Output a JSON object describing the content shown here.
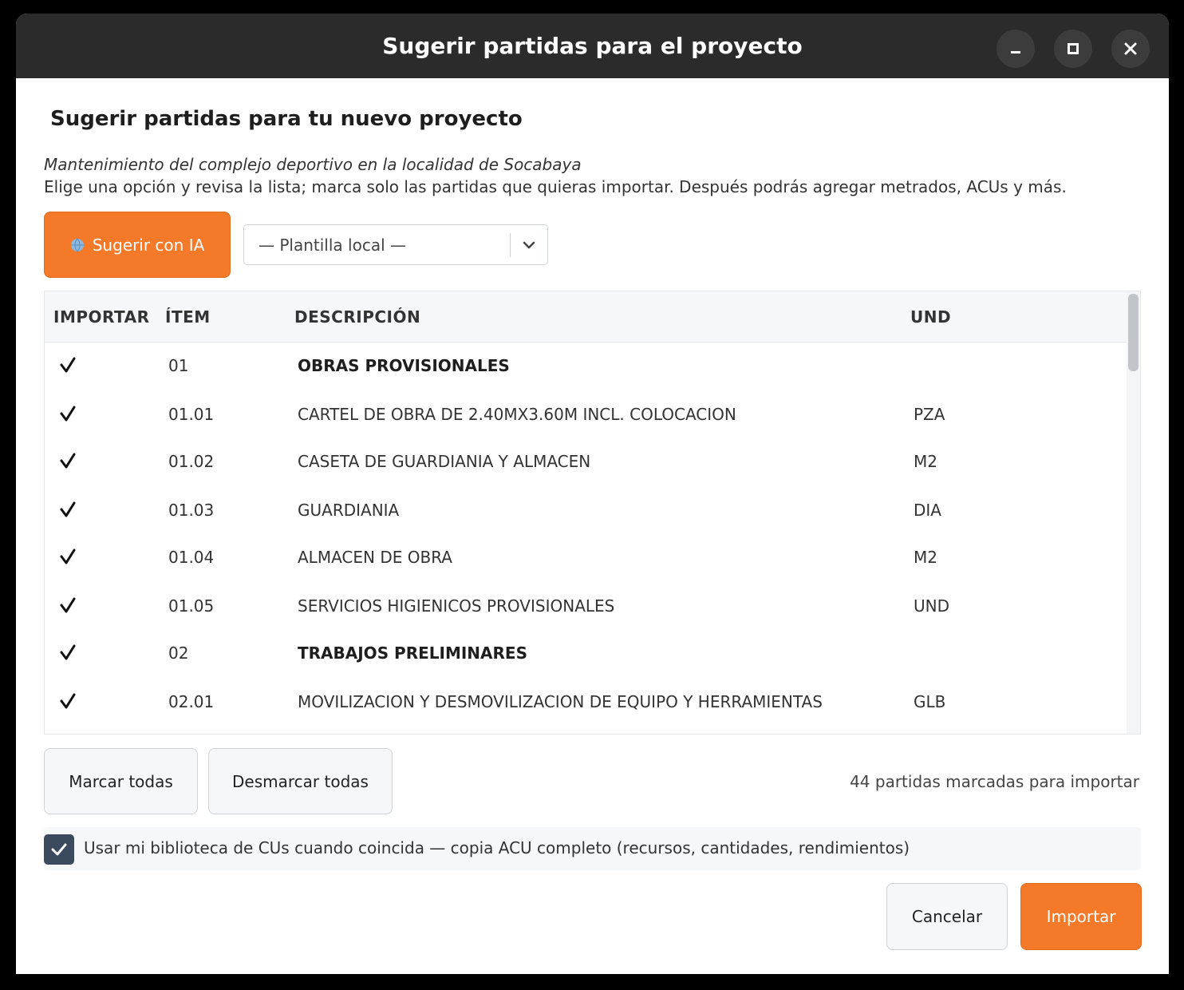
{
  "window": {
    "title": "Sugerir partidas para el proyecto",
    "controls": [
      "minimize-icon",
      "maximize-icon",
      "close-icon"
    ]
  },
  "header": {
    "title": "Sugerir partidas para tu nuevo proyecto",
    "project_name": "Mantenimiento del complejo deportivo en la localidad de Socabaya",
    "instructions": "Elige una opción y revisa la lista; marca solo las partidas que quieras importar. Después podrás agregar metrados, ACUs y más."
  },
  "toolbar": {
    "suggest_ai_label": "Sugerir con IA",
    "suggest_ai_icon": "globe-icon",
    "template_select_value": "— Plantilla local —"
  },
  "table": {
    "columns": {
      "importar": "IMPORTAR",
      "item": "ÍTEM",
      "descripcion": "DESCRIPCIÓN",
      "und": "UND"
    },
    "rows": [
      {
        "checked": true,
        "item": "01",
        "descripcion": "OBRAS PROVISIONALES",
        "und": "",
        "is_group": true
      },
      {
        "checked": true,
        "item": "01.01",
        "descripcion": "CARTEL DE OBRA DE 2.40MX3.60M INCL. COLOCACION",
        "und": "PZA",
        "is_group": false
      },
      {
        "checked": true,
        "item": "01.02",
        "descripcion": "CASETA DE GUARDIANIA Y ALMACEN",
        "und": "M2",
        "is_group": false
      },
      {
        "checked": true,
        "item": "01.03",
        "descripcion": "GUARDIANIA",
        "und": "DIA",
        "is_group": false
      },
      {
        "checked": true,
        "item": "01.04",
        "descripcion": "ALMACEN DE OBRA",
        "und": "M2",
        "is_group": false
      },
      {
        "checked": true,
        "item": "01.05",
        "descripcion": "SERVICIOS HIGIENICOS PROVISIONALES",
        "und": "UND",
        "is_group": false
      },
      {
        "checked": true,
        "item": "02",
        "descripcion": "TRABAJOS PRELIMINARES",
        "und": "",
        "is_group": true
      },
      {
        "checked": true,
        "item": "02.01",
        "descripcion": "MOVILIZACION Y DESMOVILIZACION DE EQUIPO Y HERRAMIENTAS",
        "und": "GLB",
        "is_group": false
      }
    ]
  },
  "actions": {
    "mark_all_label": "Marcar todas",
    "unmark_all_label": "Desmarcar todas",
    "count_text": "44 partidas marcadas para importar"
  },
  "library": {
    "checked": true,
    "label": "Usar mi biblioteca de CUs cuando coincida — copia ACU completo (recursos, cantidades, rendimientos)"
  },
  "footer": {
    "cancel_label": "Cancelar",
    "import_label": "Importar"
  },
  "colors": {
    "accent": "#f47a2a",
    "titlebar": "#2b2b2b",
    "checkbox": "#3b4a5e"
  }
}
